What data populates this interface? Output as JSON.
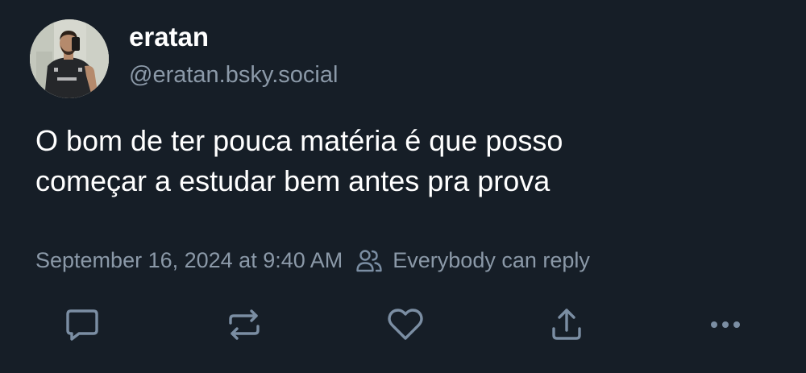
{
  "author": {
    "display_name": "eratan",
    "handle": "@eratan.bsky.social",
    "avatar_icon": "avatar-photo-icon"
  },
  "post": {
    "text_line_1": "O bom de ter pouca matéria é que posso",
    "text_line_2": "começar a estudar bem antes pra prova"
  },
  "meta": {
    "timestamp": "September 16, 2024 at 9:40 AM",
    "reply_setting_icon": "people-icon",
    "reply_setting": "Everybody can reply"
  },
  "actions": [
    {
      "name": "reply",
      "icon": "comment-icon"
    },
    {
      "name": "repost",
      "icon": "repost-icon"
    },
    {
      "name": "like",
      "icon": "heart-icon"
    },
    {
      "name": "share",
      "icon": "share-icon"
    },
    {
      "name": "more",
      "icon": "more-horizontal-icon"
    }
  ],
  "colors": {
    "background": "#161e27",
    "primary_text": "#ffffff",
    "secondary_text": "#8b99a8",
    "icon": "#7b8ea3"
  }
}
